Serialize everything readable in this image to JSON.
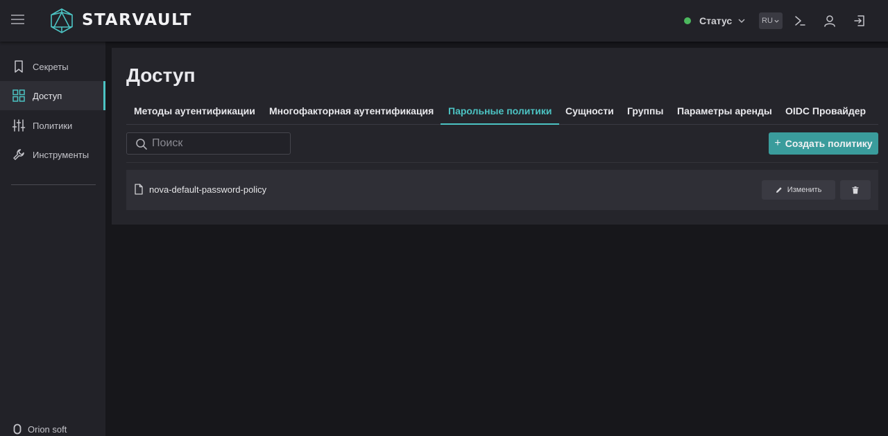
{
  "app": {
    "name": "STARVAULT",
    "menu_icon": "hamburger-icon",
    "logo_icon": "polyhedron-logo"
  },
  "header": {
    "status_label": "Статус",
    "status_color": "#4cb85e",
    "language": "RU",
    "icons": [
      "terminal-icon",
      "user-icon",
      "logout-icon"
    ]
  },
  "sidebar": {
    "items": [
      {
        "label": "Секреты",
        "icon": "bookmark-icon",
        "active": false
      },
      {
        "label": "Доступ",
        "icon": "grid-icon",
        "active": true
      },
      {
        "label": "Политики",
        "icon": "sliders-icon",
        "active": false
      },
      {
        "label": "Инструменты",
        "icon": "wrench-icon",
        "active": false
      }
    ],
    "footer": "Orion soft"
  },
  "page": {
    "title": "Доступ",
    "tabs": [
      {
        "label": "Методы аутентификации",
        "active": false
      },
      {
        "label": "Многофакторная аутентификация",
        "active": false
      },
      {
        "label": "Парольные политики",
        "active": true
      },
      {
        "label": "Сущности",
        "active": false
      },
      {
        "label": "Группы",
        "active": false
      },
      {
        "label": "Параметры аренды",
        "active": false
      },
      {
        "label": "OIDC Провайдер",
        "active": false
      }
    ],
    "search_placeholder": "Поиск",
    "create_button": "Создать политику",
    "policies": [
      {
        "name": "nova-default-password-policy",
        "edit_label": "Изменить"
      }
    ]
  },
  "colors": {
    "accent": "#4cc3c3",
    "primary_button": "#3a9c9c"
  }
}
